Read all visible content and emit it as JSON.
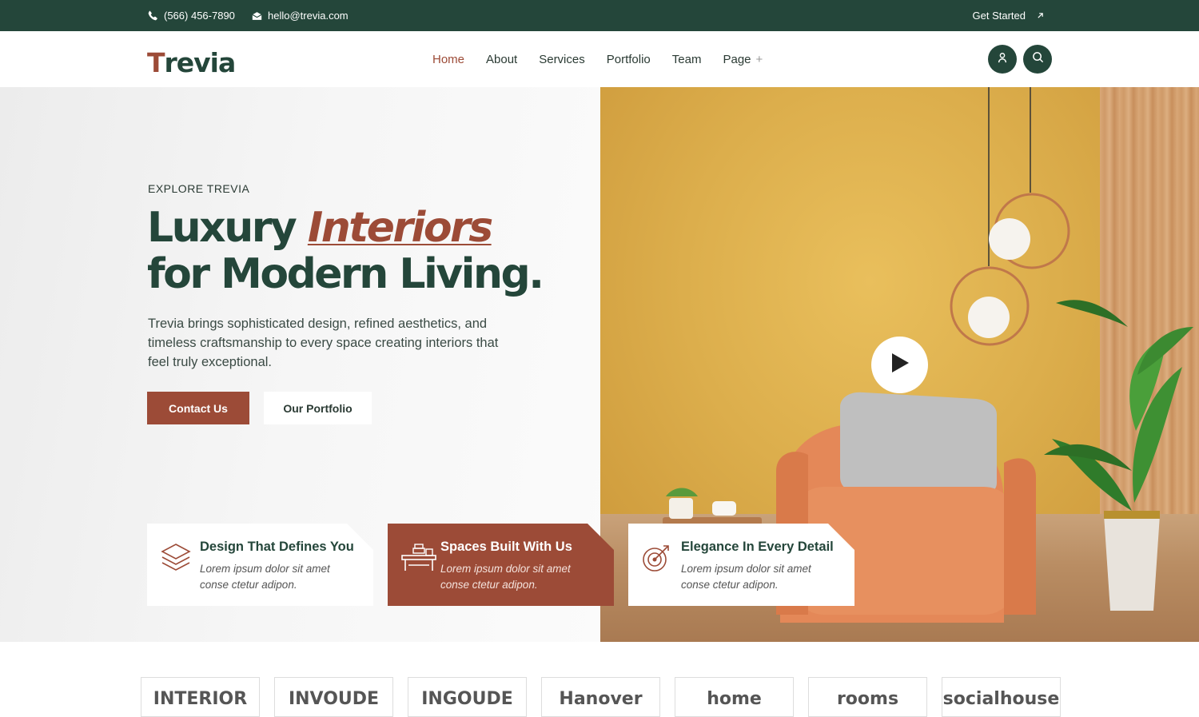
{
  "topbar": {
    "phone": "(566) 456-7890",
    "email": "hello@trevia.com",
    "cta": "Get Started",
    "phone_icon": "phone-icon",
    "email_icon": "mail-icon",
    "cta_icon": "arrow-up-right-icon"
  },
  "header": {
    "logo_first": "T",
    "logo_rest": "revia",
    "nav": [
      "Home",
      "About",
      "Services",
      "Portfolio",
      "Team",
      "Page"
    ],
    "nav_active": "Home",
    "nav_expand_glyph": "+",
    "icons": [
      "user-icon",
      "search-icon"
    ]
  },
  "hero": {
    "eyebrow": "EXPLORE TREVIA",
    "headline_part1": "Luxury ",
    "headline_accent": "Interiors",
    "headline_part2": " for Modern Living.",
    "lead": "Trevia brings sophisticated design, refined aesthetics, and timeless craftsmanship to every space creating interiors that feel truly exceptional.",
    "primary_button": "Contact Us",
    "secondary_button": "Our Portfolio",
    "play_icon": "play-icon"
  },
  "features": [
    {
      "title": "Design That Defines You",
      "desc": "Lorem ipsum dolor sit amet conse ctetur adipon.",
      "icon": "layers-icon"
    },
    {
      "title": "Spaces Built With Us",
      "desc": "Lorem ipsum dolor sit amet conse ctetur adipon.",
      "icon": "desk-icon"
    },
    {
      "title": "Elegance In Every Detail",
      "desc": "Lorem ipsum dolor sit amet conse ctetur adipon.",
      "icon": "target-icon"
    }
  ],
  "brands": [
    "INTERIOR",
    "INVOUDE",
    "INGOUDE",
    "Hanover",
    "home",
    "rooms",
    "socialhouse"
  ],
  "colors": {
    "brand_green": "#24463a",
    "brand_rust": "#9c4b37",
    "white": "#ffffff"
  }
}
